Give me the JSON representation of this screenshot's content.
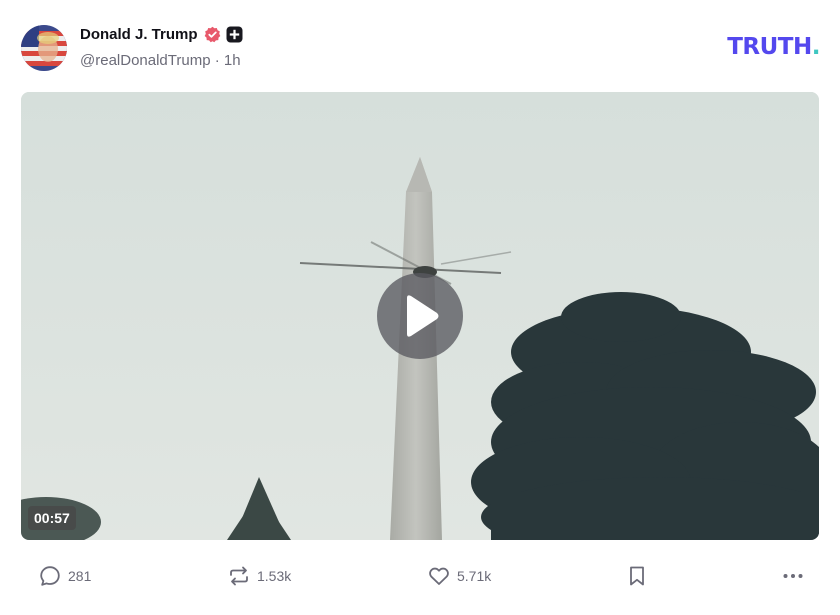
{
  "author": {
    "name": "Donald J. Trump",
    "handle": "@realDonaldTrump",
    "separator": "·",
    "time": "1h",
    "verified_badge_color": "#e8596b",
    "avatar_icon": "avatar-flag-portrait"
  },
  "brand": {
    "logo_text": "TRUTH",
    "logo_dot": ".",
    "logo_color": "#5448ee",
    "dot_color": "#3fc7c1"
  },
  "video": {
    "duration": "00:57",
    "play_icon": "play-icon"
  },
  "actions": {
    "replies": "281",
    "reposts": "1.53k",
    "likes": "5.71k",
    "reply_icon": "comment-icon",
    "repost_icon": "repost-icon",
    "like_icon": "heart-icon",
    "bookmark_icon": "bookmark-icon",
    "more_icon": "more-icon"
  }
}
